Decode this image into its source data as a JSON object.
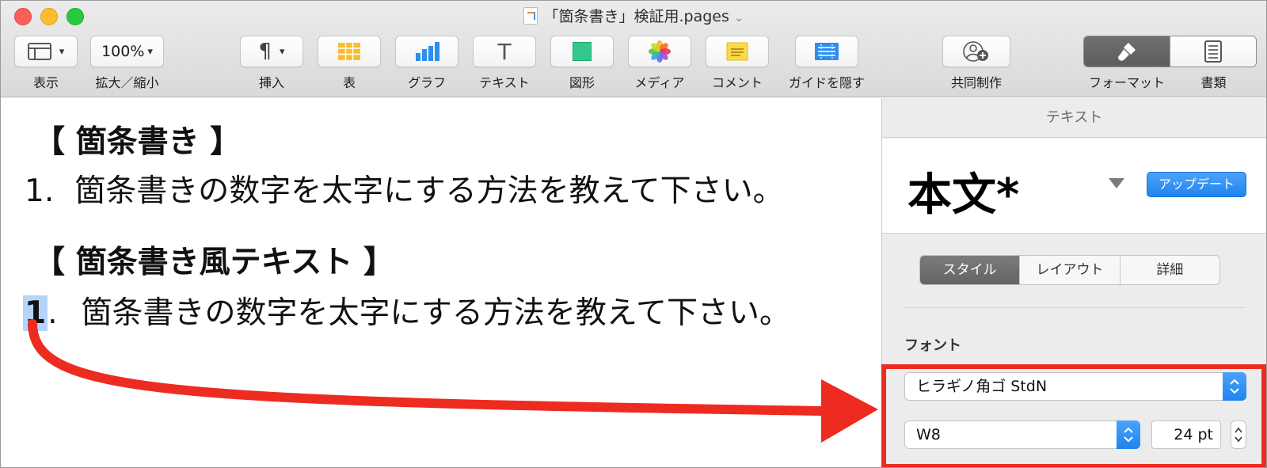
{
  "window": {
    "title": "「箇条書き」検証用.pages"
  },
  "toolbar": {
    "view_label": "表示",
    "zoom_value": "100%",
    "zoom_label": "拡大／縮小",
    "insert_label": "挿入",
    "table_label": "表",
    "chart_label": "グラフ",
    "text_label": "テキスト",
    "shape_label": "図形",
    "media_label": "メディア",
    "comment_label": "コメント",
    "guides_label": "ガイドを隠す",
    "collab_label": "共同制作",
    "format_label": "フォーマット",
    "document_label": "書類"
  },
  "document": {
    "heading1": "【 箇条書き 】",
    "item1_number": "1.",
    "item1_text": "箇条書きの数字を太字にする方法を教えて下さい。",
    "heading2": "【 箇条書き風テキスト 】",
    "item2_number_selected": "1",
    "item2_number_rest": ".",
    "item2_text": "箇条書きの数字を太字にする方法を教えて下さい。"
  },
  "inspector": {
    "header": "テキスト",
    "paragraph_style": "本文*",
    "update_button": "アップデート",
    "tabs": [
      "スタイル",
      "レイアウト",
      "詳細"
    ],
    "active_tab": "スタイル",
    "font_section_label": "フォント",
    "font_family": "ヒラギノ角ゴ StdN",
    "font_weight": "W8",
    "font_size": "24 pt"
  },
  "colors": {
    "accent_blue": "#1f84ef",
    "selection": "#b4d4fb",
    "annotation_red": "#ee2b21"
  }
}
